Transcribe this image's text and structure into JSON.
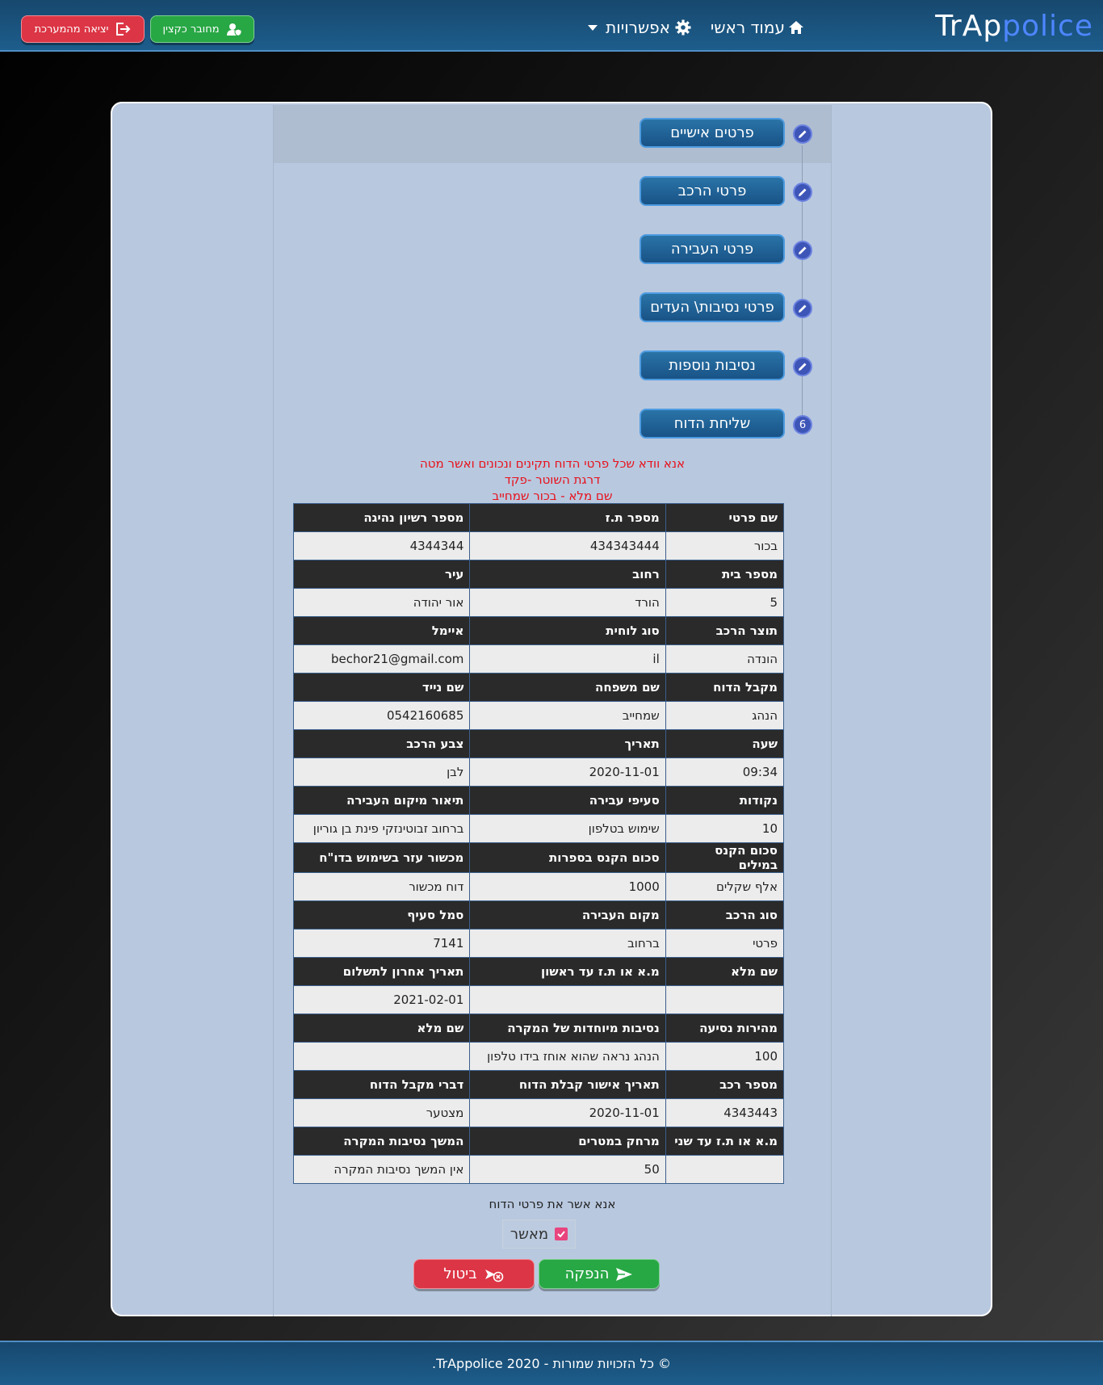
{
  "brand": {
    "part1": "TrAp",
    "part2": "police"
  },
  "nav": {
    "home": "עמוד ראשי",
    "options": "אפשרויות"
  },
  "topbar": {
    "user_label": "מחובר כקצין",
    "exit_label": "יציאה מהמערכת"
  },
  "steps": [
    {
      "label": "פרטים אישיים",
      "marker": "edit-icon"
    },
    {
      "label": "פרטי הרכב",
      "marker": "edit-icon"
    },
    {
      "label": "פרטי העבירה",
      "marker": "edit-icon"
    },
    {
      "label": "פרטי נסיבות\\ העדים",
      "marker": "edit-icon"
    },
    {
      "label": "נסיבות נוספות",
      "marker": "edit-icon"
    },
    {
      "label": "שליחת הדוח",
      "number": "6"
    }
  ],
  "declaration": {
    "line1": "אנא וודא שכל פרטי הדוח תקינים ונכונים ואשר מטה",
    "line2": "דרגת השוטר -פקד",
    "line3": "שם מלא - בכור שמחייב"
  },
  "table": {
    "rows": [
      {
        "h": [
          "שם פרטי",
          "מספר ת.ז",
          "מספר רשיון נהיגה"
        ],
        "v": [
          "בכור",
          "434343444",
          "4344344"
        ]
      },
      {
        "h": [
          "מספר בית",
          "רחוב",
          "עיר"
        ],
        "v": [
          "5",
          "הורד",
          "אור יהודה"
        ]
      },
      {
        "h": [
          "תוצר הרכב",
          "סוג לוחית",
          "איימל"
        ],
        "v": [
          "הונדה",
          "il",
          "bechor21@gmail.com"
        ]
      },
      {
        "h": [
          "מקבל הדוח",
          "שם משפחה",
          "שם נייד"
        ],
        "v": [
          "הנהג",
          "שמחייב",
          "0542160685"
        ]
      },
      {
        "h": [
          "שעה",
          "תאריך",
          "צבע הרכב"
        ],
        "v": [
          "09:34",
          "2020-11-01",
          "לבן"
        ]
      },
      {
        "h": [
          "נקודות",
          "סעיפי עבירה",
          "תיאור מיקום העבירה"
        ],
        "v": [
          "10",
          "שימוש בטלפון",
          "ברחוב זבוטינזקי פינת בן גוריון"
        ]
      },
      {
        "h": [
          "סכום הקנס במילים",
          "סכום הקנס בספרות",
          "מכשור עזר בשימוש בדו\"ח"
        ],
        "v": [
          "אלף שקלים",
          "1000",
          "דוח מכשור"
        ]
      },
      {
        "h": [
          "סוג הרכב",
          "מקום העבירה",
          "סמל סעיף"
        ],
        "v": [
          "פרטי",
          "ברחוב",
          "7141"
        ]
      },
      {
        "h": [
          "שם מלא",
          "מ.א או ת.ז עד ראשון",
          "תאריך אחרון לתשלום"
        ],
        "v": [
          "",
          "",
          "2021-02-01"
        ]
      },
      {
        "h": [
          "מהירות נסיעה",
          "נסיבות מיוחדות של המקרה",
          "שם מלא"
        ],
        "v": [
          "100",
          "הנהג נראה שהוא אוחז בידו טלפון",
          ""
        ]
      },
      {
        "h": [
          "מספר רכב",
          "תאריך אישור קבלת הדוח",
          "דברי מקבל הדוח"
        ],
        "v": [
          "4343443",
          "2020-11-01",
          "מצטער"
        ]
      },
      {
        "h": [
          "מ.א או ת.ז עד שני",
          "מרחק במטרים",
          "המשך נסיבות המקרה"
        ],
        "v": [
          "",
          "50",
          "אין המשך נסיבות המקרה"
        ]
      }
    ]
  },
  "confirm": {
    "title": "אנא אשר את פרטי הדוח",
    "checkbox_label": "מאשר",
    "checked": true
  },
  "actions": {
    "issue": "הנפקה",
    "cancel": "ביטול"
  },
  "footer": {
    "text": "© כל הזכויות שמורות - TrAppolice 2020."
  },
  "colors": {
    "accent": "#1d5d8c",
    "success": "#28a745",
    "danger": "#dc3545",
    "card": "#b8c8df",
    "step_circle": "#3e55b8",
    "alert": "#e8101a"
  }
}
